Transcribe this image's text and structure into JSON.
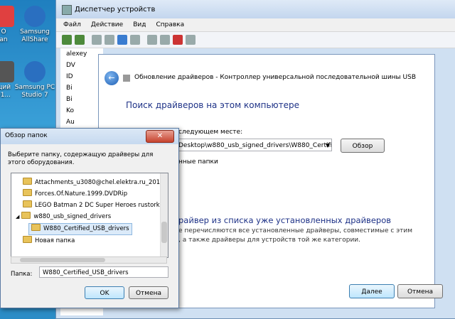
{
  "desktop": {
    "icons": [
      {
        "label": "O\nan",
        "color": "#e04040"
      },
      {
        "label": "Samsung\nAllShare",
        "color": "#2a6fc0"
      },
      {
        "label": "щий\n01...",
        "color": "#555555"
      },
      {
        "label": "Samsung PC\nStudio 7",
        "color": "#2a6fc0"
      }
    ]
  },
  "devmgr": {
    "title": "Диспетчер устройств",
    "menu": [
      "Файл",
      "Действие",
      "Вид",
      "Справка"
    ],
    "tree": [
      "alexey",
      "DV",
      "ID",
      "Bi",
      "Bi",
      "Ko",
      "Au",
      "Ko"
    ]
  },
  "update": {
    "header": "Обновление драйверов - Контроллер универсальной последовательной шины USB",
    "heading": "Поиск драйверов на этом компьютере",
    "search_label": "следующем месте:",
    "path": "Desktop\\w880_usb_signed_drivers\\W880_Certifie",
    "browse": "Обзор",
    "subfolders": "нные папки",
    "option_title": "райвер из списка уже установленных драйверов",
    "option_desc1": "е перечисляются все установленные драйверы, совместимые с этим",
    "option_desc2": ", а также драйверы для устройств той же категории.",
    "next": "Далее",
    "cancel": "Отмена"
  },
  "browse_dialog": {
    "title": "Обзор папок",
    "prompt": "Выберите папку, содержащую драйверы для этого оборудования.",
    "folders": [
      {
        "label": "Attachments_u3080@chel.elektra.ru_2012-0",
        "indent": 1,
        "selected": false
      },
      {
        "label": "Forces.Of.Nature.1999.DVDRip",
        "indent": 1,
        "selected": false
      },
      {
        "label": "LEGO Batman 2  DC Super Heroes rustorka",
        "indent": 1,
        "selected": false
      },
      {
        "label": "w880_usb_signed_drivers",
        "indent": 1,
        "selected": false,
        "expanded": true
      },
      {
        "label": "W880_Certified_USB_drivers",
        "indent": 2,
        "selected": true
      },
      {
        "label": "Новая папка",
        "indent": 1,
        "selected": false
      }
    ],
    "folder_label": "Папка:",
    "folder_value": "W880_Certified_USB_drivers",
    "ok": "OK",
    "cancel": "Отмена",
    "close": "✕"
  }
}
